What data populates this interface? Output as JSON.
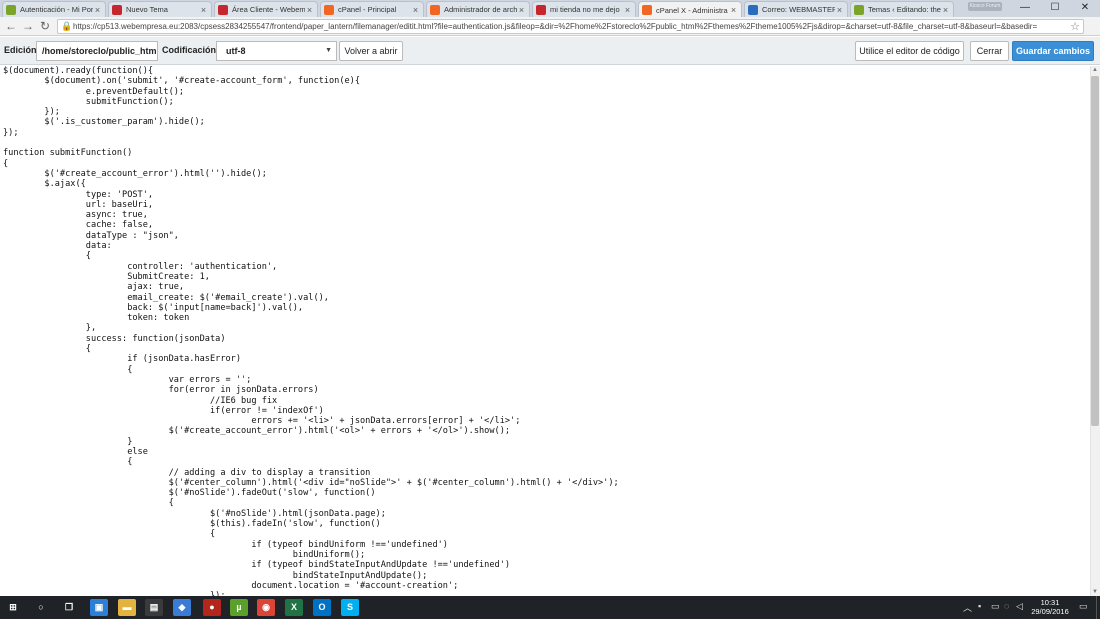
{
  "browser": {
    "tabs": [
      {
        "title": "Autenticación - Mi Por",
        "icon": "tree-favicon-icon",
        "color": "#7aa52a"
      },
      {
        "title": "Nuevo Tema",
        "icon": "w-favicon-icon",
        "color": "#c6262e"
      },
      {
        "title": "Área Cliente - Webem",
        "icon": "w-favicon-icon",
        "color": "#c6262e"
      },
      {
        "title": "cPanel - Principal",
        "icon": "cpanel-favicon-icon",
        "color": "#f26522"
      },
      {
        "title": "Administrador de arch",
        "icon": "cpanel-favicon-icon",
        "color": "#f26522"
      },
      {
        "title": "mi tienda no me dejo",
        "icon": "w-favicon-icon",
        "color": "#c6262e"
      },
      {
        "title": "cPanel X - Administra",
        "icon": "cpanel-favicon-icon",
        "color": "#f26522"
      },
      {
        "title": "Correo: WEBMASTER",
        "icon": "outlook-favicon-icon",
        "color": "#2a6ebb"
      },
      {
        "title": "Temas ‹ Editando: the",
        "icon": "tree-favicon-icon",
        "color": "#7aa52a"
      }
    ],
    "active_tab": 6,
    "new_tab_label": "Kiosco Forum",
    "window_controls": {
      "minimize": "—",
      "maximize": "☐",
      "close": "✕"
    },
    "url": "https://cp513.webempresa.eu:2083/cpsess2834255547/frontend/paper_lantern/filemanager/editit.html?file=authentication.js&fileop=&dir=%2Fhome%2Fstoreclo%2Fpublic_html%2Fthemes%2Ftheme1005%2Fjs&dirop=&charset=utf-8&file_charset=utf-8&baseurl=&basedir="
  },
  "editor": {
    "edition_label": "Edición:",
    "path": "/home/storeclo/public_html",
    "encoding_label": "Codificación:",
    "encoding_value": "utf-8",
    "reopen_button": "Volver a abrir",
    "code_editor_button": "Utilice el editor de código",
    "close_button": "Cerrar",
    "save_button": "Guardar cambios",
    "code_lines": [
      "$(document).ready(function(){",
      "\t$(document).on('submit', '#create-account_form', function(e){",
      "\t\te.preventDefault();",
      "\t\tsubmitFunction();",
      "\t});",
      "\t$('.is_customer_param').hide();",
      "});",
      "",
      "function submitFunction()",
      "{",
      "\t$('#create_account_error').html('').hide();",
      "\t$.ajax({",
      "\t\ttype: 'POST',",
      "\t\turl: baseUri,",
      "\t\tasync: true,",
      "\t\tcache: false,",
      "\t\tdataType : \"json\",",
      "\t\tdata:",
      "\t\t{",
      "\t\t\tcontroller: 'authentication',",
      "\t\t\tSubmitCreate: 1,",
      "\t\t\tajax: true,",
      "\t\t\temail_create: $('#email_create').val(),",
      "\t\t\tback: $('input[name=back]').val(),",
      "\t\t\ttoken: token",
      "\t\t},",
      "\t\tsuccess: function(jsonData)",
      "\t\t{",
      "\t\t\tif (jsonData.hasError)",
      "\t\t\t{",
      "\t\t\t\tvar errors = '';",
      "\t\t\t\tfor(error in jsonData.errors)",
      "\t\t\t\t\t//IE6 bug fix",
      "\t\t\t\t\tif(error != 'indexOf')",
      "\t\t\t\t\t\terrors += '<li>' + jsonData.errors[error] + '</li>';",
      "\t\t\t\t$('#create_account_error').html('<ol>' + errors + '</ol>').show();",
      "\t\t\t}",
      "\t\t\telse",
      "\t\t\t{",
      "\t\t\t\t// adding a div to display a transition",
      "\t\t\t\t$('#center_column').html('<div id=\"noSlide\">' + $('#center_column').html() + '</div>');",
      "\t\t\t\t$('#noSlide').fadeOut('slow', function()",
      "\t\t\t\t{",
      "\t\t\t\t\t$('#noSlide').html(jsonData.page);",
      "\t\t\t\t\t$(this).fadeIn('slow', function()",
      "\t\t\t\t\t{",
      "\t\t\t\t\t\tif (typeof bindUniform !=='undefined')",
      "\t\t\t\t\t\t\tbindUniform();",
      "\t\t\t\t\t\tif (typeof bindStateInputAndUpdate !=='undefined')",
      "\t\t\t\t\t\t\tbindStateInputAndUpdate();",
      "\t\t\t\t\t\tdocument.location = '#account-creation';",
      "\t\t\t\t\t});"
    ]
  },
  "taskbar": {
    "apps": [
      {
        "name": "start-button",
        "glyph": "⊞",
        "color": "#1f2226"
      },
      {
        "name": "cortana-icon",
        "glyph": "○",
        "color": "#1f2226"
      },
      {
        "name": "task-view-icon",
        "glyph": "❐",
        "color": "#1f2226"
      },
      {
        "name": "photos-app-icon",
        "glyph": "▣",
        "color": "#2d7fd6"
      },
      {
        "name": "file-explorer-icon",
        "glyph": "▬",
        "color": "#e3b341"
      },
      {
        "name": "store-icon",
        "glyph": "▤",
        "color": "#3a3a3a"
      },
      {
        "name": "vpn-app-icon",
        "glyph": "◆",
        "color": "#3a7bd5"
      },
      {
        "name": "media-player-icon",
        "glyph": "●",
        "color": "#b3261e"
      },
      {
        "name": "utorrent-icon",
        "glyph": "µ",
        "color": "#5aa02c"
      },
      {
        "name": "chrome-icon",
        "glyph": "◉",
        "color": "#db4437"
      },
      {
        "name": "excel-icon",
        "glyph": "X",
        "color": "#217346"
      },
      {
        "name": "outlook-icon",
        "glyph": "O",
        "color": "#0072c6"
      },
      {
        "name": "skype-icon",
        "glyph": "S",
        "color": "#00aff0"
      }
    ],
    "time": "10:31",
    "date": "29/09/2016"
  }
}
